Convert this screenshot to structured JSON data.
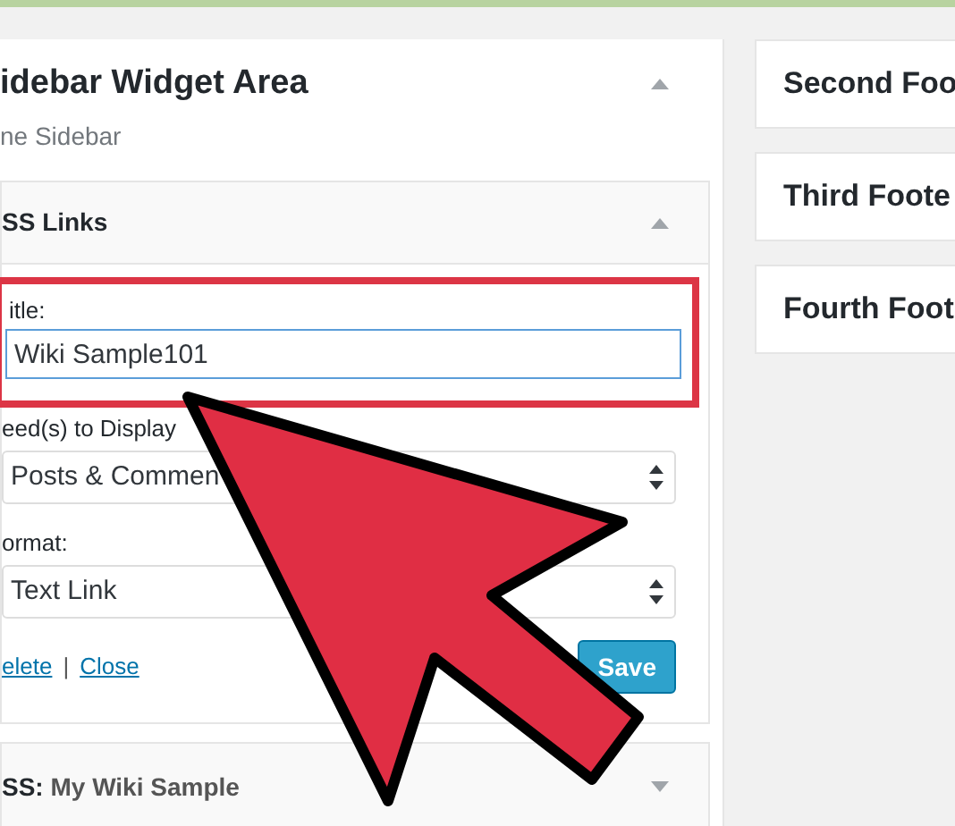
{
  "sidebar_area": {
    "title": "idebar Widget Area",
    "description": "ne Sidebar",
    "expanded": true
  },
  "widgets": [
    {
      "title": "SS Links",
      "expanded": true,
      "fields": [
        {
          "kind": "text",
          "label": "itle:",
          "value": "Wiki Sample101",
          "highlighted": true
        },
        {
          "kind": "select",
          "label": "eed(s) to Display",
          "value": "Posts & Commen",
          "highlighted": false
        },
        {
          "kind": "select",
          "label": "ormat:",
          "value": "Text Link",
          "highlighted": false
        }
      ],
      "links": [
        "elete",
        "Close"
      ],
      "separator": "|",
      "save_button": "Save"
    },
    {
      "title_prefix": "SS:",
      "title": "My Wiki Sample",
      "expanded": false
    }
  ],
  "footer_areas": [
    {
      "title": "Second Foo"
    },
    {
      "title": "Third Foote"
    },
    {
      "title": "Fourth Foot"
    }
  ]
}
